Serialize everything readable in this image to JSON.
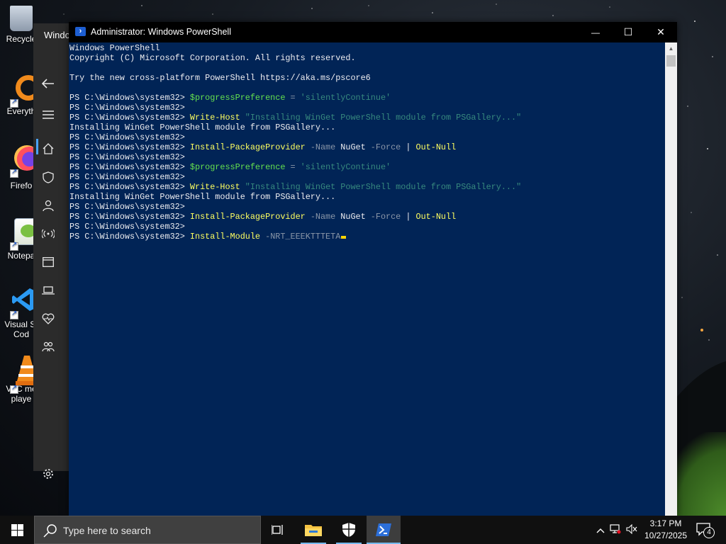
{
  "desktop": {
    "icons": [
      {
        "label": "Recycle",
        "icon": "recycle-bin-icon"
      },
      {
        "label": "Everyth",
        "icon": "everything-search-icon"
      },
      {
        "label": "Firefo",
        "icon": "firefox-icon"
      },
      {
        "label": "Notepa",
        "icon": "notepad-plus-plus-icon"
      },
      {
        "label": "Visual St\nCod",
        "icon": "vscode-icon"
      },
      {
        "label": "VLC me\nplaye",
        "icon": "vlc-icon"
      }
    ]
  },
  "settings_window": {
    "title": "Windo",
    "rail": [
      "back-arrow-icon",
      "hamburger-menu-icon",
      "home-icon",
      "shield-icon",
      "person-icon",
      "antenna-icon",
      "window-icon",
      "laptop-icon",
      "heart-pulse-icon",
      "family-icon",
      "gear-icon"
    ]
  },
  "powershell": {
    "title": "Administrator: Windows PowerShell",
    "buttons": {
      "minimize": "—",
      "maximize": "☐",
      "close": "✕"
    },
    "lines": [
      [
        {
          "t": "Windows PowerShell",
          "c": "c-prompt"
        }
      ],
      [
        {
          "t": "Copyright (C) Microsoft Corporation. All rights reserved.",
          "c": "c-prompt"
        }
      ],
      [],
      [
        {
          "t": "Try the new cross-platform PowerShell https://aka.ms/pscore6",
          "c": "c-prompt"
        }
      ],
      [],
      [
        {
          "t": "PS C:\\Windows\\system32> ",
          "c": "c-prompt"
        },
        {
          "t": "$progressPreference",
          "c": "c-var"
        },
        {
          "t": " = ",
          "c": "c-op"
        },
        {
          "t": "'silentlyContinue'",
          "c": "c-str"
        }
      ],
      [
        {
          "t": "PS C:\\Windows\\system32> ",
          "c": "c-prompt"
        }
      ],
      [
        {
          "t": "PS C:\\Windows\\system32> ",
          "c": "c-prompt"
        },
        {
          "t": "Write-Host",
          "c": "c-cmd"
        },
        {
          "t": " ",
          "c": "c-arg"
        },
        {
          "t": "\"Installing WinGet PowerShell module from PSGallery...\"",
          "c": "c-str"
        }
      ],
      [
        {
          "t": "Installing WinGet PowerShell module from PSGallery...",
          "c": "c-prompt"
        }
      ],
      [
        {
          "t": "PS C:\\Windows\\system32> ",
          "c": "c-prompt"
        }
      ],
      [
        {
          "t": "PS C:\\Windows\\system32> ",
          "c": "c-prompt"
        },
        {
          "t": "Install-PackageProvider",
          "c": "c-cmd"
        },
        {
          "t": " -Name ",
          "c": "c-param"
        },
        {
          "t": "NuGet",
          "c": "c-arg"
        },
        {
          "t": " -Force ",
          "c": "c-param"
        },
        {
          "t": "| ",
          "c": "c-arg"
        },
        {
          "t": "Out-Null",
          "c": "c-cmd"
        }
      ],
      [
        {
          "t": "PS C:\\Windows\\system32> ",
          "c": "c-prompt"
        }
      ],
      [
        {
          "t": "PS C:\\Windows\\system32> ",
          "c": "c-prompt"
        },
        {
          "t": "$progressPreference",
          "c": "c-var"
        },
        {
          "t": " = ",
          "c": "c-op"
        },
        {
          "t": "'silentlyContinue'",
          "c": "c-str"
        }
      ],
      [
        {
          "t": "PS C:\\Windows\\system32> ",
          "c": "c-prompt"
        }
      ],
      [
        {
          "t": "PS C:\\Windows\\system32> ",
          "c": "c-prompt"
        },
        {
          "t": "Write-Host",
          "c": "c-cmd"
        },
        {
          "t": " ",
          "c": "c-arg"
        },
        {
          "t": "\"Installing WinGet PowerShell module from PSGallery...\"",
          "c": "c-str"
        }
      ],
      [
        {
          "t": "Installing WinGet PowerShell module from PSGallery...",
          "c": "c-prompt"
        }
      ],
      [
        {
          "t": "PS C:\\Windows\\system32> ",
          "c": "c-prompt"
        }
      ],
      [
        {
          "t": "PS C:\\Windows\\system32> ",
          "c": "c-prompt"
        },
        {
          "t": "Install-PackageProvider",
          "c": "c-cmd"
        },
        {
          "t": " -Name ",
          "c": "c-param"
        },
        {
          "t": "NuGet",
          "c": "c-arg"
        },
        {
          "t": " -Force ",
          "c": "c-param"
        },
        {
          "t": "| ",
          "c": "c-arg"
        },
        {
          "t": "Out-Null",
          "c": "c-cmd"
        }
      ],
      [
        {
          "t": "PS C:\\Windows\\system32> ",
          "c": "c-prompt"
        }
      ],
      [
        {
          "t": "PS C:\\Windows\\system32> ",
          "c": "c-prompt"
        },
        {
          "t": "Install-Module",
          "c": "c-cmd"
        },
        {
          "t": " -NRT_EEEKTTTETA",
          "c": "c-param"
        }
      ]
    ]
  },
  "taskbar": {
    "search_placeholder": "Type here to search",
    "pinned": [
      "task-view-icon",
      "file-explorer-icon",
      "windows-security-icon",
      "powershell-icon"
    ],
    "active": "powershell-icon",
    "tray": [
      "chevron-up-icon",
      "network-icon",
      "volume-muted-icon"
    ],
    "time": "3:17 PM",
    "date": "10/27/2025",
    "notification_count": "4"
  },
  "colors": {
    "console_bg": "#012456",
    "command": "#ffff60",
    "parameter": "#8a96a8",
    "string": "#37897e",
    "variable": "#65e04e",
    "accent": "#76b9ed"
  }
}
